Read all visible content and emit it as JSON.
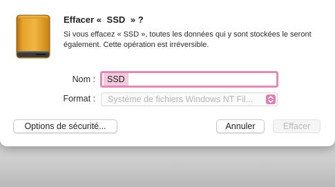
{
  "dialog": {
    "title_prefix": "Effacer «",
    "title_name": "SSD",
    "title_suffix": "» ?",
    "message_part1": "Si vous effacez «",
    "message_name": "SSD",
    "message_part2": "», toutes les données qui y sont stockées le seront également. Cette opération est irréversible.",
    "icon": "external-drive-icon"
  },
  "form": {
    "name_label": "Nom :",
    "name_value": "SSD",
    "format_label": "Format :",
    "format_value": "Système de fichiers Windows NT Fil...",
    "format_icon": "updown-chevron-icon"
  },
  "buttons": {
    "security_options": "Options de sécurité...",
    "cancel": "Annuler",
    "erase": "Effacer"
  },
  "colors": {
    "accent": "#dd7fb1",
    "focus_ring": "#e08ab9",
    "selection": "#f3c9de",
    "drive_body": "#d9921f"
  }
}
